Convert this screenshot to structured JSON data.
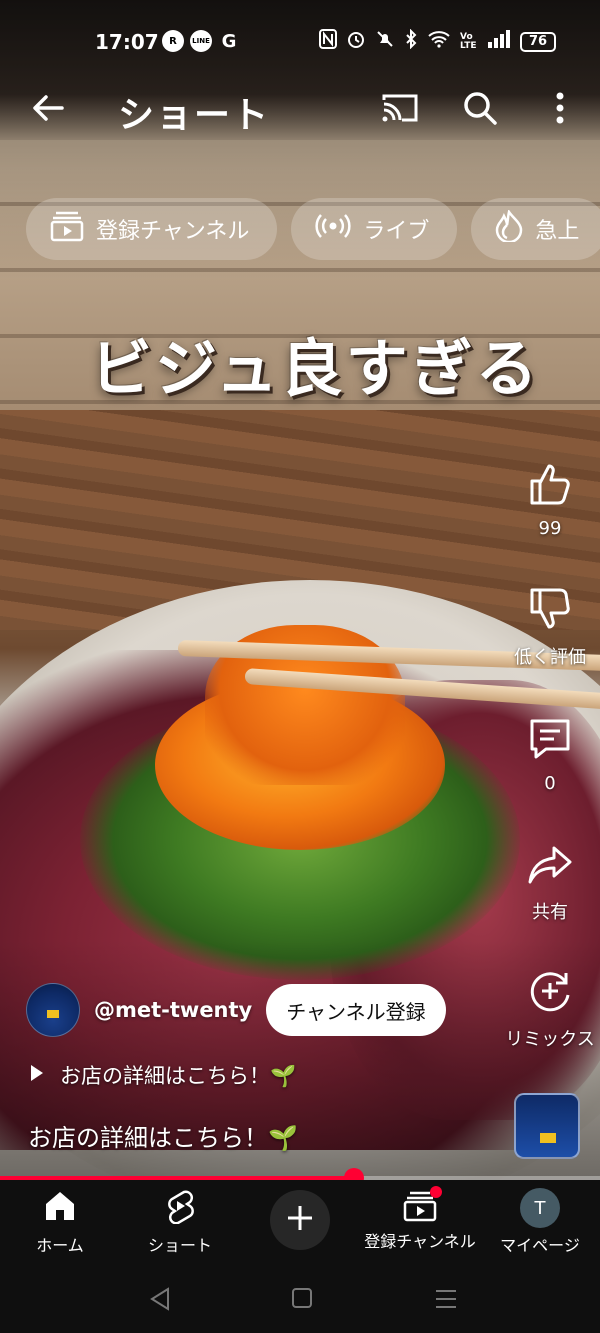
{
  "status_bar": {
    "time": "17:07",
    "app_icons": [
      "R",
      "LINE",
      "G"
    ],
    "battery": "76",
    "network": "VoLTE"
  },
  "header": {
    "title": "ショート",
    "icons": [
      "back-arrow-icon",
      "cast-icon",
      "search-icon",
      "more-vert-icon"
    ]
  },
  "chips": [
    {
      "label": "登録チャンネル",
      "icon": "subscriptions-icon"
    },
    {
      "label": "ライブ",
      "icon": "live-icon"
    },
    {
      "label": "急上",
      "icon": "trending-icon"
    }
  ],
  "video": {
    "overlay_caption": "ビジュ良すぎる",
    "progress_percent": 59
  },
  "actions": {
    "like_count": "99",
    "dislike_label": "低く評価",
    "comment_count": "0",
    "share_label": "共有",
    "remix_label": "リミックス"
  },
  "channel": {
    "handle": "@met-twenty",
    "subscribe_label": "チャンネル登録"
  },
  "description": {
    "link_text": "お店の詳細はこちら！🌱",
    "text": "お店の詳細はこちら！🌱"
  },
  "bottom_nav": {
    "items": [
      {
        "label": "ホーム",
        "icon": "home-icon"
      },
      {
        "label": "ショート",
        "icon": "shorts-icon"
      },
      {
        "label": "",
        "icon": "create-plus-icon"
      },
      {
        "label": "登録チャンネル",
        "icon": "subscriptions-icon"
      },
      {
        "label": "マイページ",
        "icon": "user-avatar"
      }
    ],
    "avatar_letter": "T"
  },
  "colors": {
    "accent": "#ff0033",
    "nav_bg": "#0f0f0f"
  }
}
